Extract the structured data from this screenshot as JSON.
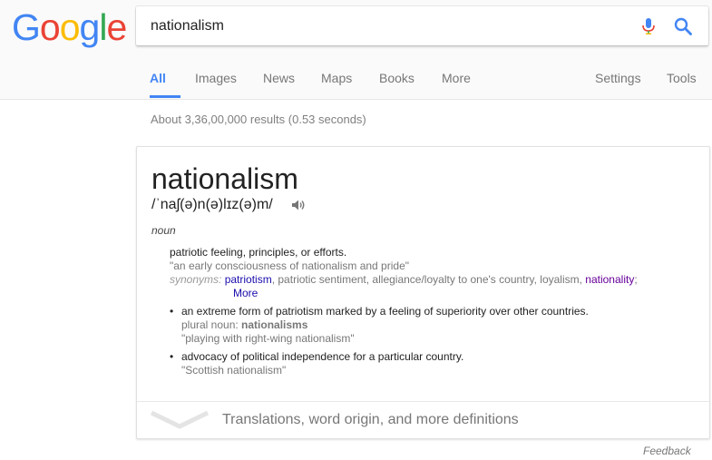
{
  "logo": {
    "letters": [
      "G",
      "o",
      "o",
      "g",
      "l",
      "e"
    ],
    "colors": [
      "#4285f4",
      "#ea4335",
      "#fbbc05",
      "#4285f4",
      "#34a853",
      "#ea4335"
    ]
  },
  "search": {
    "value": "nationalism",
    "mic_icon": "microphone-icon",
    "search_icon": "search-icon"
  },
  "tabs": {
    "all": "All",
    "images": "Images",
    "news": "News",
    "maps": "Maps",
    "books": "Books",
    "more": "More",
    "settings": "Settings",
    "tools": "Tools"
  },
  "result_stats": "About 3,36,00,000 results (0.53 seconds)",
  "definition": {
    "word": "nationalism",
    "phonetic": "/ˈnaʃ(ə)n(ə)lɪz(ə)m/",
    "speaker_icon": "speaker-icon",
    "part_of_speech": "noun",
    "sense1": {
      "text": "patriotic feeling, principles, or efforts.",
      "example": "\"an early consciousness of nationalism and pride\"",
      "synonyms_label": "synonyms:",
      "synonym_patriotism": "patriotism",
      "synonym_plain": ", patriotic sentiment, allegiance/loyalty to one's country, loyalism, ",
      "synonym_nationality": "nationality",
      "synonym_end": ";",
      "more": "More"
    },
    "sense2": {
      "bullet": "•",
      "text": "an extreme form of patriotism marked by a feeling of superiority over other countries.",
      "plural_label": "plural noun: ",
      "plural_word": "nationalisms",
      "example": "\"playing with right-wing nationalism\""
    },
    "sense3": {
      "bullet": "•",
      "text": "advocacy of political independence for a particular country.",
      "example": "\"Scottish nationalism\""
    },
    "expand_text": "Translations, word origin, and more definitions",
    "expand_icon": "chevron-down-icon"
  },
  "feedback": "Feedback",
  "colors": {
    "accent": "#4285f4",
    "link": "#1a0dab",
    "visited_link": "#660099"
  }
}
